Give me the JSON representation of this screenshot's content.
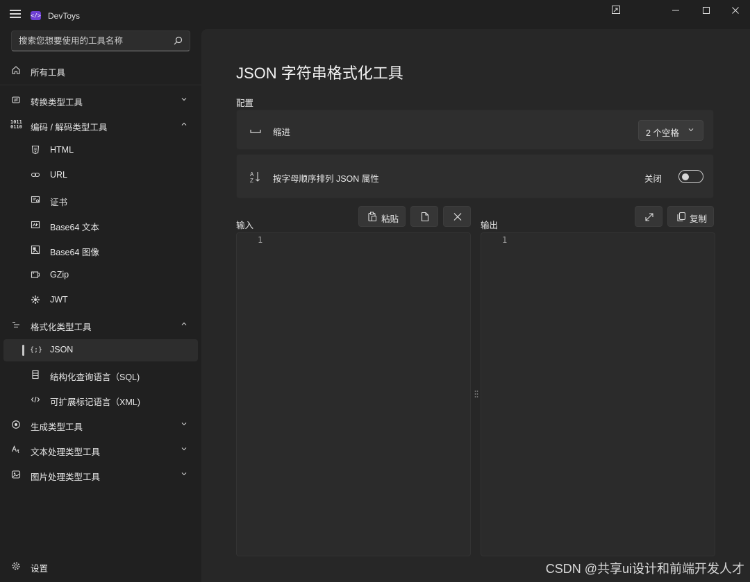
{
  "window": {
    "title": "DevToys"
  },
  "search": {
    "placeholder": "搜索您想要使用的工具名称"
  },
  "nav": {
    "all_tools": "所有工具",
    "converters": "转换类型工具",
    "encoders": "编码 / 解码类型工具",
    "encoders_children": [
      "HTML",
      "URL",
      "证书",
      "Base64 文本",
      "Base64 图像",
      "GZip",
      "JWT"
    ],
    "formatters": "格式化类型工具",
    "formatters_children": [
      "JSON",
      "结构化查询语言（SQL)",
      "可扩展标记语言（XML)"
    ],
    "generators": "生成类型工具",
    "text": "文本处理类型工具",
    "graphic": "图片处理类型工具",
    "settings": "设置"
  },
  "page": {
    "title": "JSON 字符串格式化工具",
    "config_label": "配置",
    "indent_label": "缩进",
    "indent_value": "2 个空格",
    "sort_label": "按字母顺序排列 JSON 属性",
    "sort_toggle_state": "关闭",
    "input_label": "输入",
    "output_label": "输出",
    "paste_label": "粘贴",
    "copy_label": "复制",
    "input_line": "1",
    "output_line": "1"
  },
  "watermark": "CSDN @共享ui设计和前端开发人才",
  "colors": {
    "accent_logo": "#6d3fd1",
    "background": "#202020",
    "content": "#272727"
  }
}
